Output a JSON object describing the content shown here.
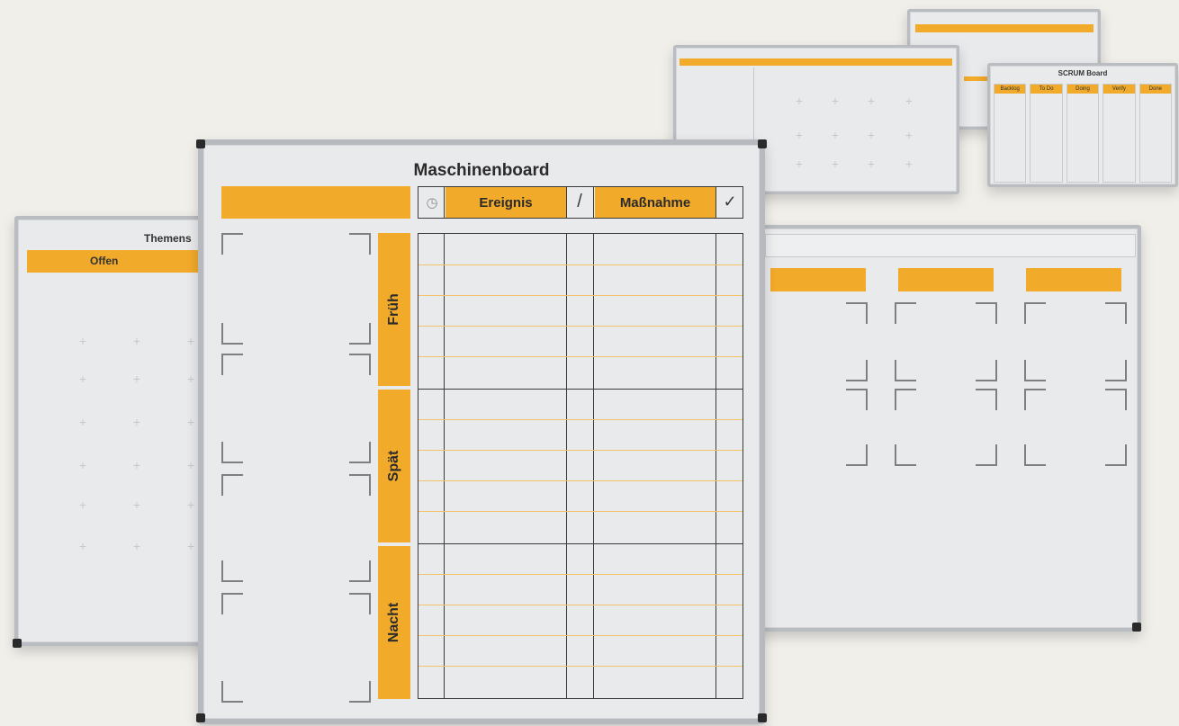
{
  "boards": {
    "back_top": {
      "title": "",
      "brand_color": "#f2aa2a"
    },
    "scrum": {
      "title": "SCRUM Board",
      "columns": [
        "Backlog",
        "To Do",
        "Doing",
        "Verify",
        "Done"
      ]
    },
    "middle": {
      "header_left": "",
      "header_center": "",
      "header_right": ""
    },
    "themen": {
      "title": "Themens",
      "column_label": "Offen"
    },
    "right": {},
    "main": {
      "title": "Maschinenboard",
      "col_event": "Ereignis",
      "col_action": "Maßnahme",
      "clock_symbol": "◷",
      "slash_symbol": "/",
      "check_symbol": "✓",
      "shifts": [
        "Früh",
        "Spät",
        "Nacht"
      ]
    }
  },
  "colors": {
    "accent": "#f2aa2a",
    "frame": "#b9bcc1",
    "background": "#f1efea"
  }
}
